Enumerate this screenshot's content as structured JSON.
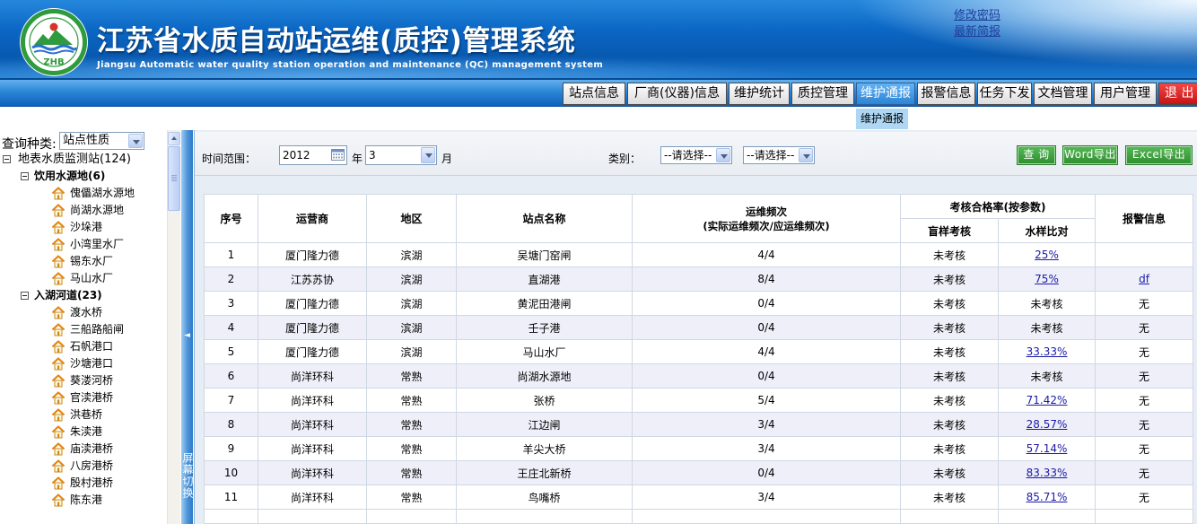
{
  "header": {
    "logo_text": "ZHB",
    "title": "江苏省水质自动站运维(质控)管理系统",
    "subtitle": "Jiangsu Automatic water quality station operation and maintenance (QC) management system",
    "links": {
      "change_password": "修改密码",
      "latest_brief": "最新简报"
    }
  },
  "nav": {
    "tabs": [
      "站点信息",
      "厂商(仪器)信息",
      "维护统计",
      "质控管理",
      "维护通报",
      "报警信息",
      "任务下发",
      "文档管理",
      "用户管理",
      "退 出"
    ],
    "active_index": 4,
    "subtab": "维护通报"
  },
  "sidebar": {
    "query_label": "查询种类:",
    "query_value": "站点性质",
    "root_label": "地表水质监测站(124)",
    "groups": [
      {
        "label": "饮用水源地(6)",
        "items": [
          "傀儡湖水源地",
          "尚湖水源地",
          "沙垛港",
          "小湾里水厂",
          "锡东水厂",
          "马山水厂"
        ]
      },
      {
        "label": "入湖河道(23)",
        "items": [
          "渡水桥",
          "三船路船闸",
          "石帆港口",
          "沙塘港口",
          "葵溇河桥",
          "官渎港桥",
          "洪巷桥",
          "朱渎港",
          "庙渎港桥",
          "八房港桥",
          "殷村港桥",
          "陈东港"
        ]
      }
    ]
  },
  "splitter": {
    "arrow": "◄",
    "label": "屏幕切换"
  },
  "filters": {
    "time_label": "时间范围：",
    "year_value": "2012",
    "year_unit": "年",
    "month_value": "3",
    "month_unit": "月",
    "category_label": "类别：",
    "category1_value": "--请选择--",
    "category2_value": "--请选择--",
    "query_button": "查 询",
    "word_button": "Word导出",
    "excel_button": "Excel导出"
  },
  "table": {
    "headers": {
      "no": "序号",
      "operator": "运营商",
      "region": "地区",
      "station": "站点名称",
      "freq": "运维频次",
      "freq_note": "(实际运维频次/应运维频次)",
      "pass_rate": "考核合格率(按参数)",
      "blind": "盲样考核",
      "compare": "水样比对",
      "alarm": "报警信息"
    },
    "rows": [
      {
        "no": "1",
        "operator": "厦门隆力德",
        "region": "滨湖",
        "station": "吴塘门窑闸",
        "freq": "4/4",
        "blind": "未考核",
        "compare": {
          "text": "25%",
          "link": true
        },
        "alarm": {
          "text": "",
          "link": false
        }
      },
      {
        "no": "2",
        "operator": "江苏苏协",
        "region": "滨湖",
        "station": "直湖港",
        "freq": "8/4",
        "blind": "未考核",
        "compare": {
          "text": "75%",
          "link": true
        },
        "alarm": {
          "text": "df",
          "link": true
        }
      },
      {
        "no": "3",
        "operator": "厦门隆力德",
        "region": "滨湖",
        "station": "黄泥田港闸",
        "freq": "0/4",
        "blind": "未考核",
        "compare": {
          "text": "未考核",
          "link": false
        },
        "alarm": {
          "text": "无",
          "link": false
        }
      },
      {
        "no": "4",
        "operator": "厦门隆力德",
        "region": "滨湖",
        "station": "壬子港",
        "freq": "0/4",
        "blind": "未考核",
        "compare": {
          "text": "未考核",
          "link": false
        },
        "alarm": {
          "text": "无",
          "link": false
        }
      },
      {
        "no": "5",
        "operator": "厦门隆力德",
        "region": "滨湖",
        "station": "马山水厂",
        "freq": "4/4",
        "blind": "未考核",
        "compare": {
          "text": "33.33%",
          "link": true
        },
        "alarm": {
          "text": "无",
          "link": false
        }
      },
      {
        "no": "6",
        "operator": "尚洋环科",
        "region": "常熟",
        "station": "尚湖水源地",
        "freq": "0/4",
        "blind": "未考核",
        "compare": {
          "text": "未考核",
          "link": false
        },
        "alarm": {
          "text": "无",
          "link": false
        }
      },
      {
        "no": "7",
        "operator": "尚洋环科",
        "region": "常熟",
        "station": "张桥",
        "freq": "5/4",
        "blind": "未考核",
        "compare": {
          "text": "71.42%",
          "link": true
        },
        "alarm": {
          "text": "无",
          "link": false
        }
      },
      {
        "no": "8",
        "operator": "尚洋环科",
        "region": "常熟",
        "station": "江边闸",
        "freq": "3/4",
        "blind": "未考核",
        "compare": {
          "text": "28.57%",
          "link": true
        },
        "alarm": {
          "text": "无",
          "link": false
        }
      },
      {
        "no": "9",
        "operator": "尚洋环科",
        "region": "常熟",
        "station": "羊尖大桥",
        "freq": "3/4",
        "blind": "未考核",
        "compare": {
          "text": "57.14%",
          "link": true
        },
        "alarm": {
          "text": "无",
          "link": false
        }
      },
      {
        "no": "10",
        "operator": "尚洋环科",
        "region": "常熟",
        "station": "王庄北新桥",
        "freq": "0/4",
        "blind": "未考核",
        "compare": {
          "text": "83.33%",
          "link": true
        },
        "alarm": {
          "text": "无",
          "link": false
        }
      },
      {
        "no": "11",
        "operator": "尚洋环科",
        "region": "常熟",
        "station": "鸟嘴桥",
        "freq": "3/4",
        "blind": "未考核",
        "compare": {
          "text": "85.71%",
          "link": true
        },
        "alarm": {
          "text": "无",
          "link": false
        }
      }
    ]
  },
  "colors": {
    "active_tab": "#2c84d6",
    "exit_tab": "#c81212",
    "button_green": "#2f8f2f",
    "link": "#1a1aa8",
    "stripe_row": "#efeff9"
  }
}
